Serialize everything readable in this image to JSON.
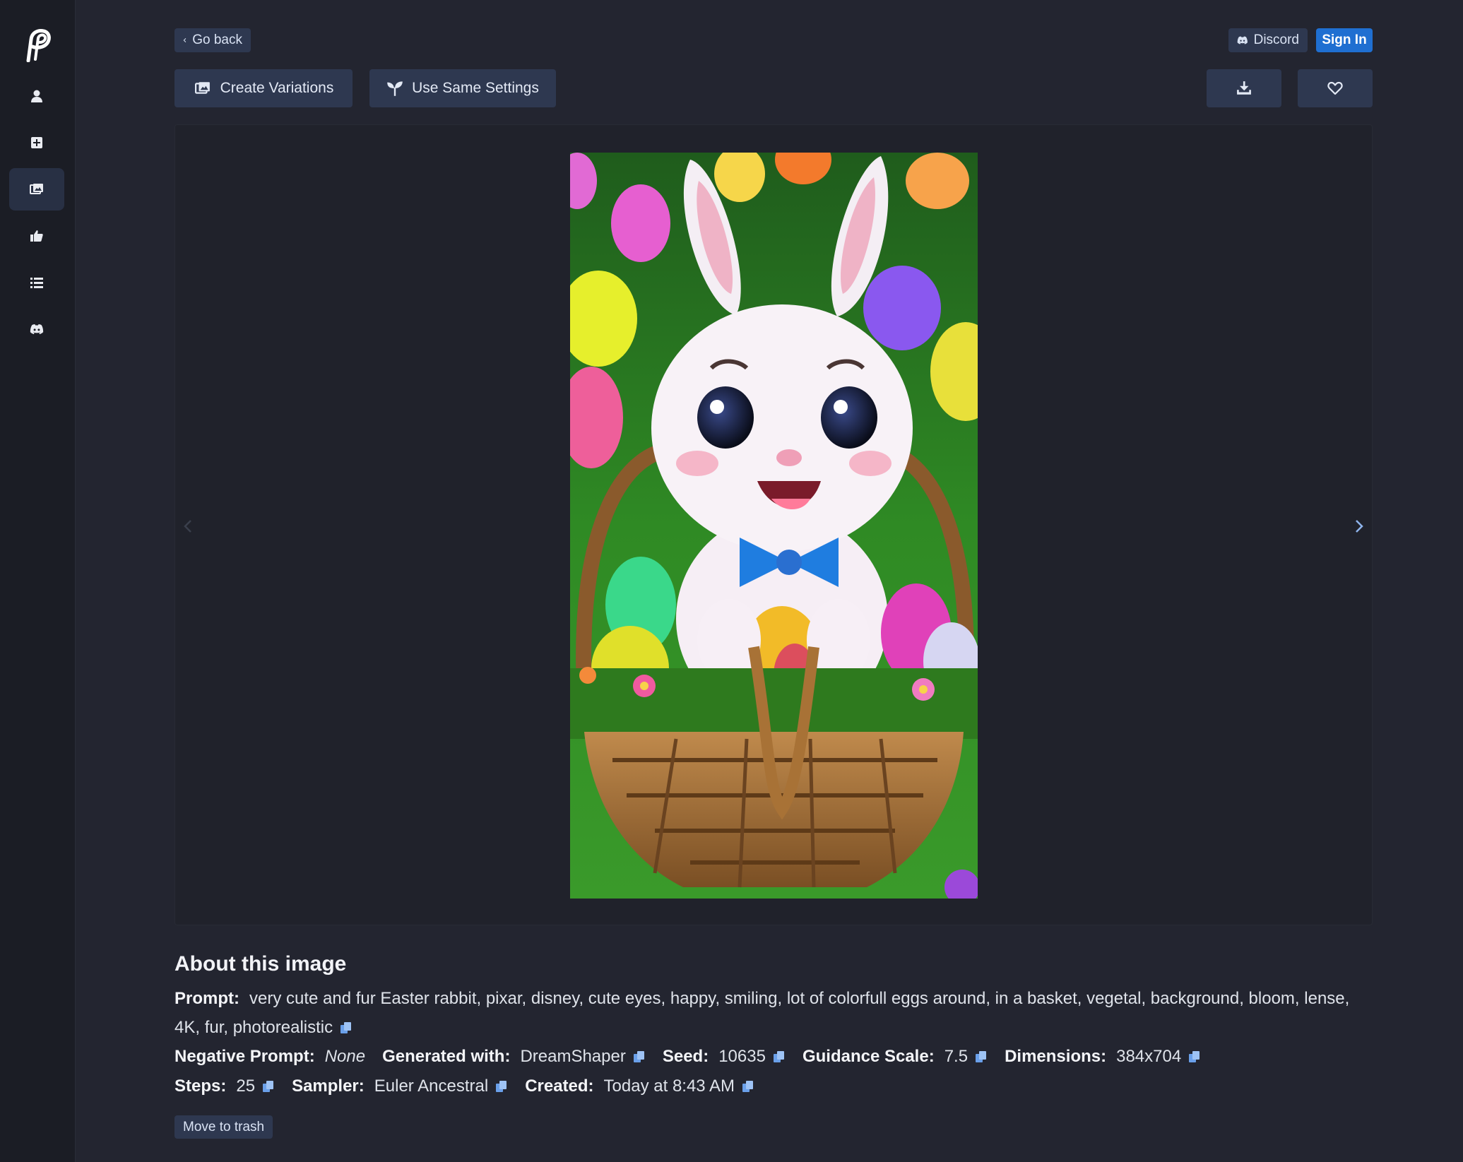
{
  "header": {
    "go_back": "Go back",
    "discord": "Discord",
    "sign_in": "Sign In"
  },
  "toolbar": {
    "create_variations": "Create Variations",
    "use_same_settings": "Use Same Settings"
  },
  "sidebar": {
    "items": [
      {
        "icon": "user-icon"
      },
      {
        "icon": "plus-square-icon"
      },
      {
        "icon": "images-icon",
        "active": true
      },
      {
        "icon": "thumbs-up-icon"
      },
      {
        "icon": "list-icon"
      },
      {
        "icon": "discord-icon"
      }
    ]
  },
  "about": {
    "title": "About this image",
    "prompt_label": "Prompt:",
    "prompt": "very cute and fur Easter rabbit, pixar, disney, cute eyes, happy, smiling, lot of colorfull eggs around, in a basket, vegetal, background, bloom, lense, 4K, fur, photorealistic",
    "negative_label": "Negative Prompt:",
    "negative": "None",
    "generated_label": "Generated with:",
    "generated": "DreamShaper",
    "seed_label": "Seed:",
    "seed": "10635",
    "guidance_label": "Guidance Scale:",
    "guidance": "7.5",
    "dimensions_label": "Dimensions:",
    "dimensions": "384x704",
    "steps_label": "Steps:",
    "steps": "25",
    "sampler_label": "Sampler:",
    "sampler": "Euler Ancestral",
    "created_label": "Created:",
    "created": "Today at 8:43 AM"
  },
  "actions": {
    "move_to_trash": "Move to trash"
  },
  "colors": {
    "background": "#232530",
    "sidebar": "#1b1d25",
    "button": "#2e3850",
    "primary": "#1f6fd1"
  }
}
